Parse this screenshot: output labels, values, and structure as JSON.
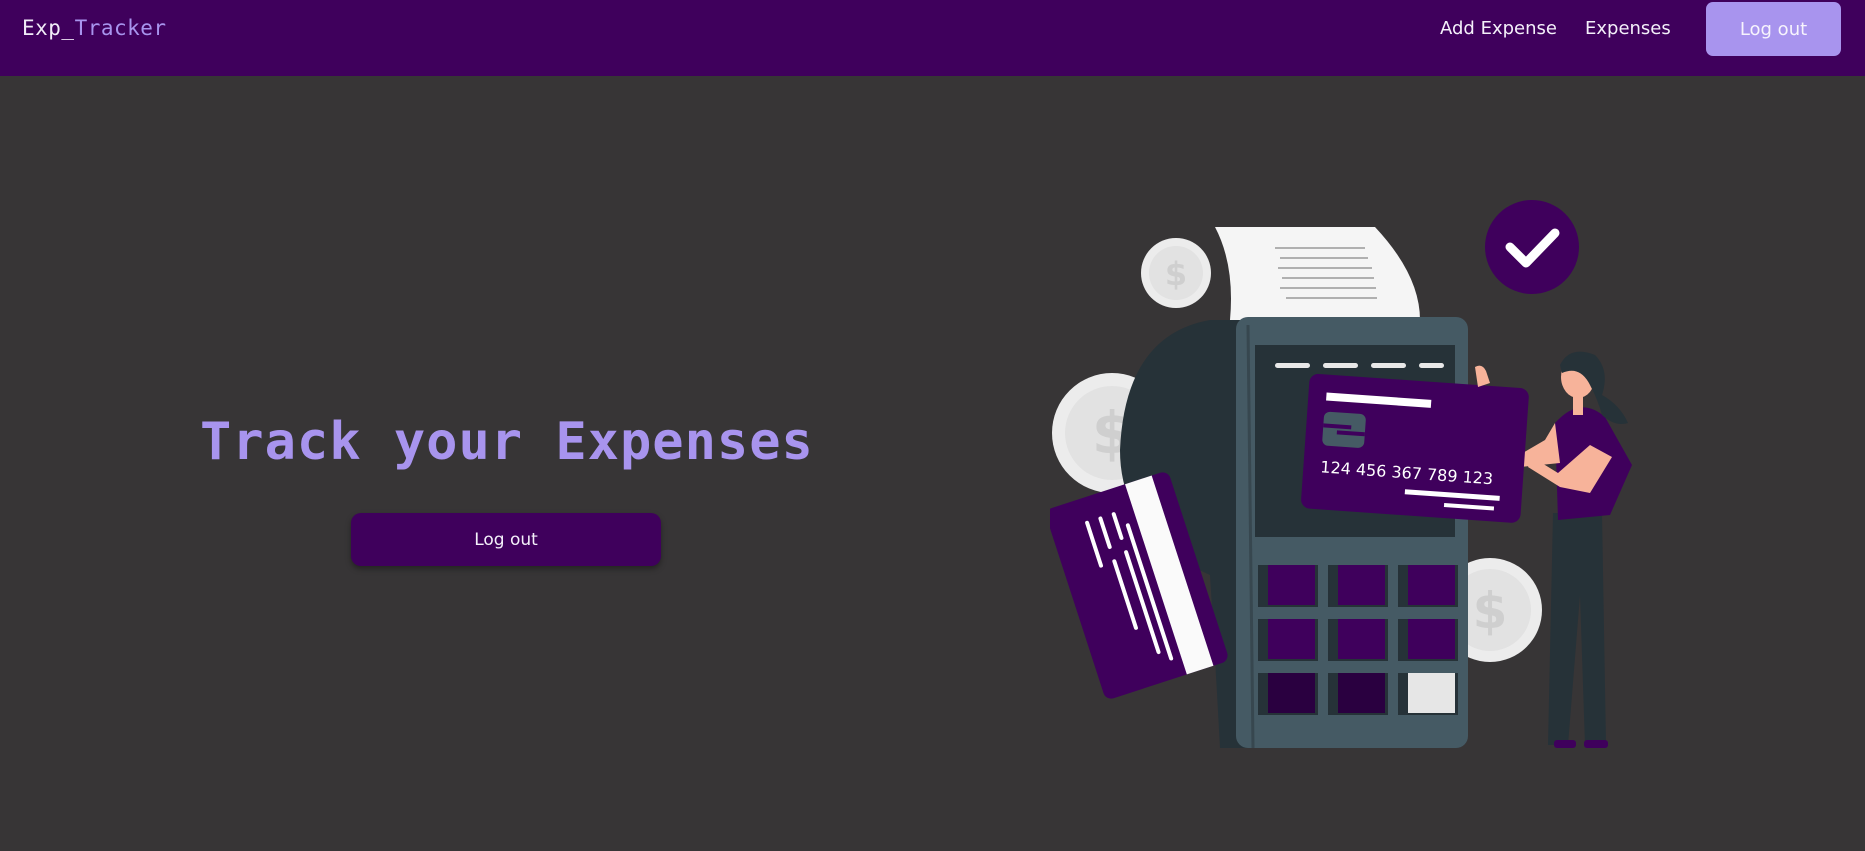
{
  "app": {
    "brand_prefix": "Exp_",
    "brand_suffix": "Tracker"
  },
  "nav": {
    "add_expense": "Add Expense",
    "expenses": "Expenses",
    "logout": "Log out"
  },
  "hero": {
    "title": "Track your Expenses",
    "logout_button": "Log out"
  },
  "illustration": {
    "card_number": "124 456 367 789 123",
    "currency_symbol": "$"
  },
  "colors": {
    "background": "#373536",
    "navbar": "#3f005c",
    "accent": "#a894ee",
    "terminal": "#455a64",
    "terminal_dark": "#263238"
  }
}
